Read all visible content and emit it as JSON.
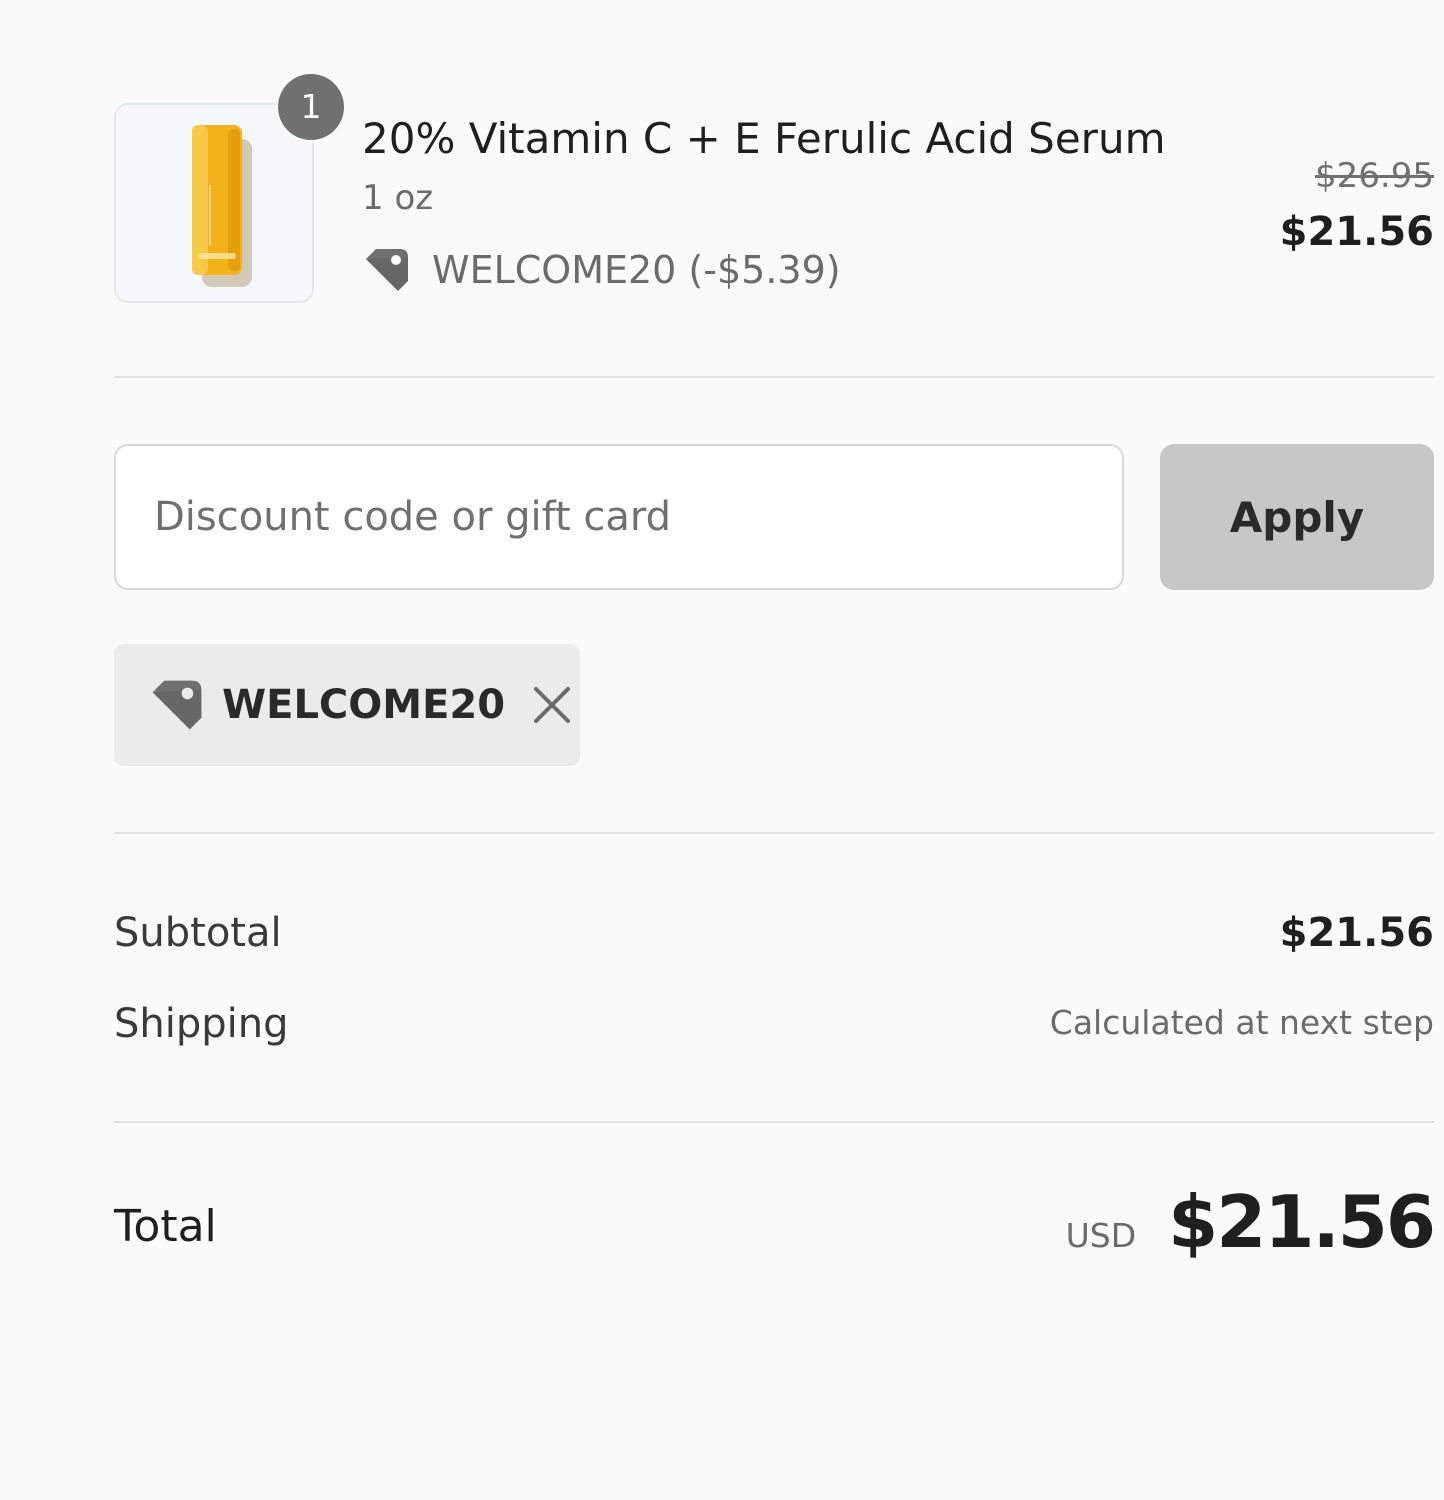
{
  "line_item": {
    "quantity": "1",
    "title": "20% Vitamin C + E Ferulic Acid Serum",
    "variant": "1 oz",
    "discount_text": "WELCOME20 (-$5.39)",
    "original_price": "$26.95",
    "price": "$21.56",
    "thumbnail_icon": "serum-bottle-icon",
    "bottle_color": "#f2b21a"
  },
  "discount_form": {
    "placeholder": "Discount code or gift card",
    "value": "",
    "apply_label": "Apply"
  },
  "applied_code": {
    "label": "WELCOME20",
    "icon": "tag-icon",
    "remove_icon": "close-icon"
  },
  "summary": {
    "subtotal_label": "Subtotal",
    "subtotal_value": "$21.56",
    "shipping_label": "Shipping",
    "shipping_value": "Calculated at next step",
    "total_label": "Total",
    "currency": "USD",
    "total_value": "$21.56"
  },
  "colors": {
    "background": "#fafafa",
    "apply_button": "#c7c7c7",
    "chip_background": "#ebebeb",
    "badge": "#707070"
  }
}
